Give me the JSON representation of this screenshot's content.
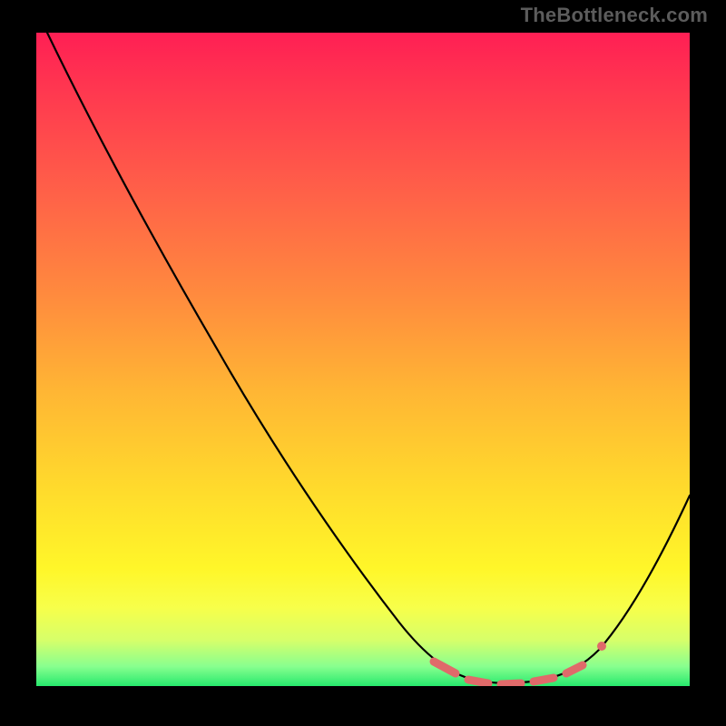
{
  "watermark": "TheBottleneck.com",
  "colors": {
    "gradient_top": "#ff1f54",
    "gradient_mid": "#ffdb2c",
    "gradient_bottom": "#27e96d",
    "curve_stroke": "#000000",
    "dash_stroke": "#e06a6a",
    "background": "#000000"
  },
  "chart_data": {
    "type": "line",
    "title": "",
    "xlabel": "",
    "ylabel": "",
    "xlim": [
      0,
      100
    ],
    "ylim": [
      0,
      100
    ],
    "x": [
      0,
      5,
      10,
      15,
      20,
      25,
      30,
      35,
      40,
      45,
      50,
      55,
      60,
      63,
      66,
      70,
      74,
      78,
      82,
      86,
      90,
      95,
      100
    ],
    "values": [
      100,
      92,
      83,
      75,
      67,
      58,
      50,
      42,
      34,
      27,
      20,
      13,
      7,
      3,
      1,
      0,
      0,
      0,
      1,
      4,
      9,
      17,
      27
    ],
    "markers": {
      "x": [
        63,
        66.5,
        70,
        73.5,
        77,
        80.5,
        84
      ],
      "y": [
        3,
        1,
        0,
        0,
        0,
        1,
        4
      ],
      "style": "pink-dash"
    },
    "grid": false,
    "legend": false
  }
}
